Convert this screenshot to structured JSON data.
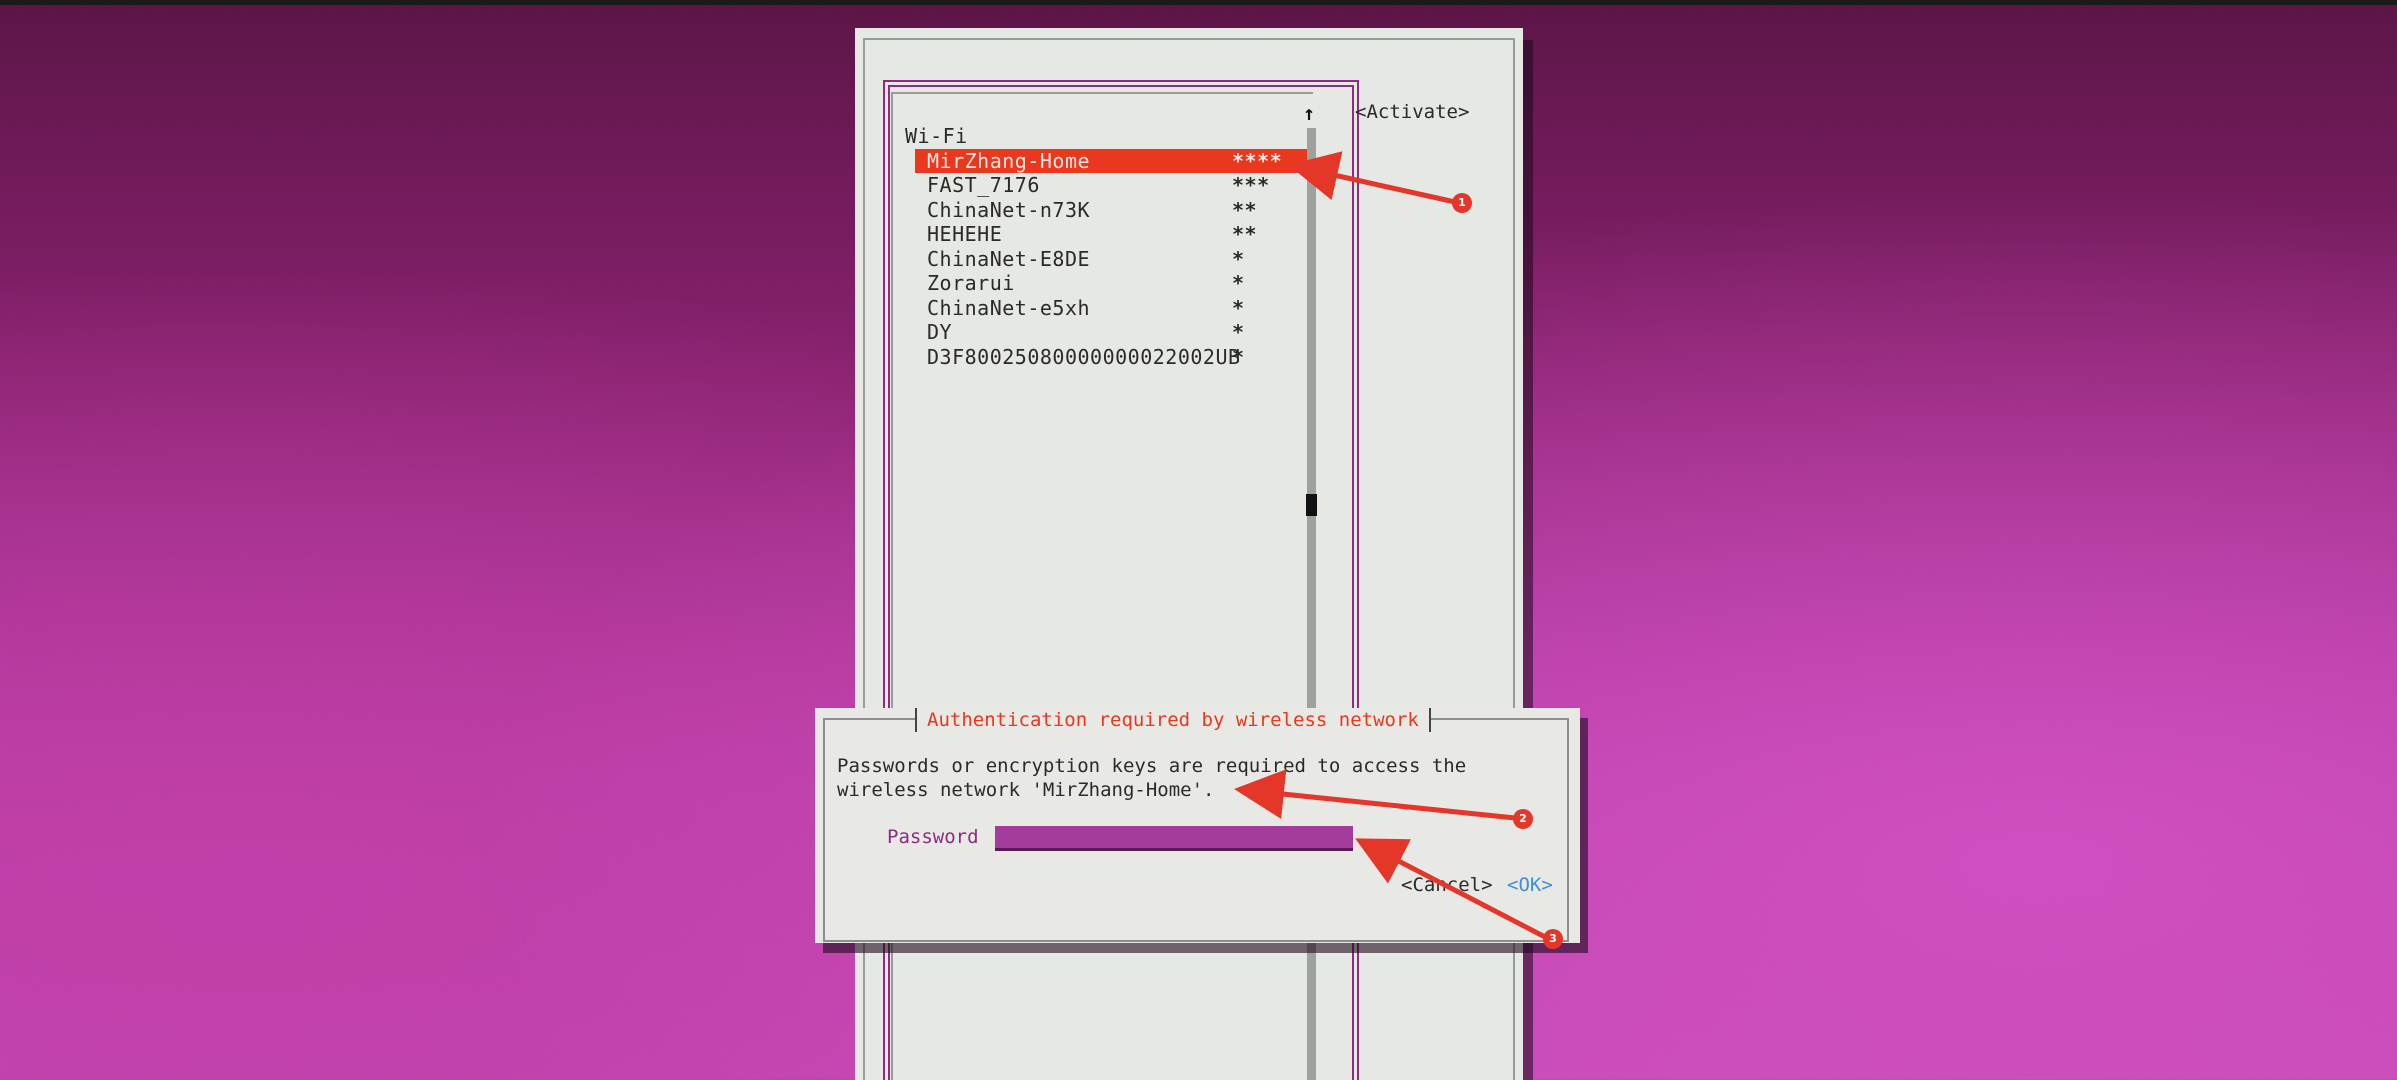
{
  "screen": {
    "activate_button": "<Activate>",
    "scroll_up_arrow": "↑"
  },
  "wifi_list": {
    "section_title": "Wi-Fi",
    "networks": [
      {
        "ssid": "MirZhang-Home",
        "signal": "****",
        "selected": true
      },
      {
        "ssid": "FAST_7176",
        "signal": "***"
      },
      {
        "ssid": "ChinaNet-n73K",
        "signal": "**"
      },
      {
        "ssid": "HEHEHE",
        "signal": "**"
      },
      {
        "ssid": "ChinaNet-E8DE",
        "signal": "*"
      },
      {
        "ssid": "Zorarui",
        "signal": "*"
      },
      {
        "ssid": "ChinaNet-e5xh",
        "signal": "*"
      },
      {
        "ssid": "DY",
        "signal": "*"
      },
      {
        "ssid": "D3F80025080000000022002UB",
        "signal": "*"
      }
    ]
  },
  "dialog": {
    "title": "Authentication required by wireless network",
    "message_line1": "Passwords or encryption keys are required to access the",
    "message_line2": "wireless network 'MirZhang-Home'.",
    "password_label": "Password",
    "password_value": "",
    "cancel_label": "<Cancel>",
    "ok_label": "<OK>"
  },
  "annotations": [
    {
      "label": "1"
    },
    {
      "label": "2"
    },
    {
      "label": "3"
    }
  ],
  "colors": {
    "highlight": "#e8381e",
    "field": "#a43c9b",
    "frame": "#8b2c80",
    "ok": "#3f8fd6",
    "annotation": "#e5362a"
  }
}
